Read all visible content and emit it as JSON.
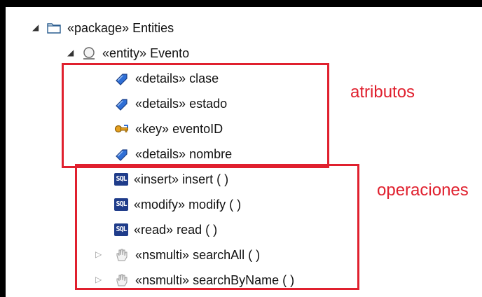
{
  "tree": {
    "package": {
      "stereo": "«package»",
      "name": "Entities"
    },
    "entity": {
      "stereo": "«entity»",
      "name": "Evento"
    },
    "attributes": [
      {
        "stereo": "«details»",
        "name": "clase",
        "icon": "attribute-diamond-icon"
      },
      {
        "stereo": "«details»",
        "name": "estado",
        "icon": "attribute-diamond-icon"
      },
      {
        "stereo": "«key»",
        "name": "eventoID",
        "icon": "key-icon"
      },
      {
        "stereo": "«details»",
        "name": "nombre",
        "icon": "attribute-diamond-icon"
      }
    ],
    "operations": [
      {
        "stereo": "«insert»",
        "name": "insert ( )",
        "icon": "sql-icon",
        "sql_label": "SQL"
      },
      {
        "stereo": "«modify»",
        "name": "modify ( )",
        "icon": "sql-icon",
        "sql_label": "SQL"
      },
      {
        "stereo": "«read»",
        "name": "read ( )",
        "icon": "sql-icon",
        "sql_label": "SQL"
      },
      {
        "stereo": "«nsmulti»",
        "name": "searchAll ( )",
        "icon": "hand-icon"
      },
      {
        "stereo": "«nsmulti»",
        "name": "searchByName ( )",
        "icon": "hand-icon"
      }
    ]
  },
  "annotations": {
    "attributes_label": "atributos",
    "operations_label": "operaciones"
  },
  "colors": {
    "annotation_red": "#e0202e",
    "attribute_blue": "#2f6fd6",
    "sql_navy": "#1f3c8a",
    "key_orange": "#e5a020"
  }
}
